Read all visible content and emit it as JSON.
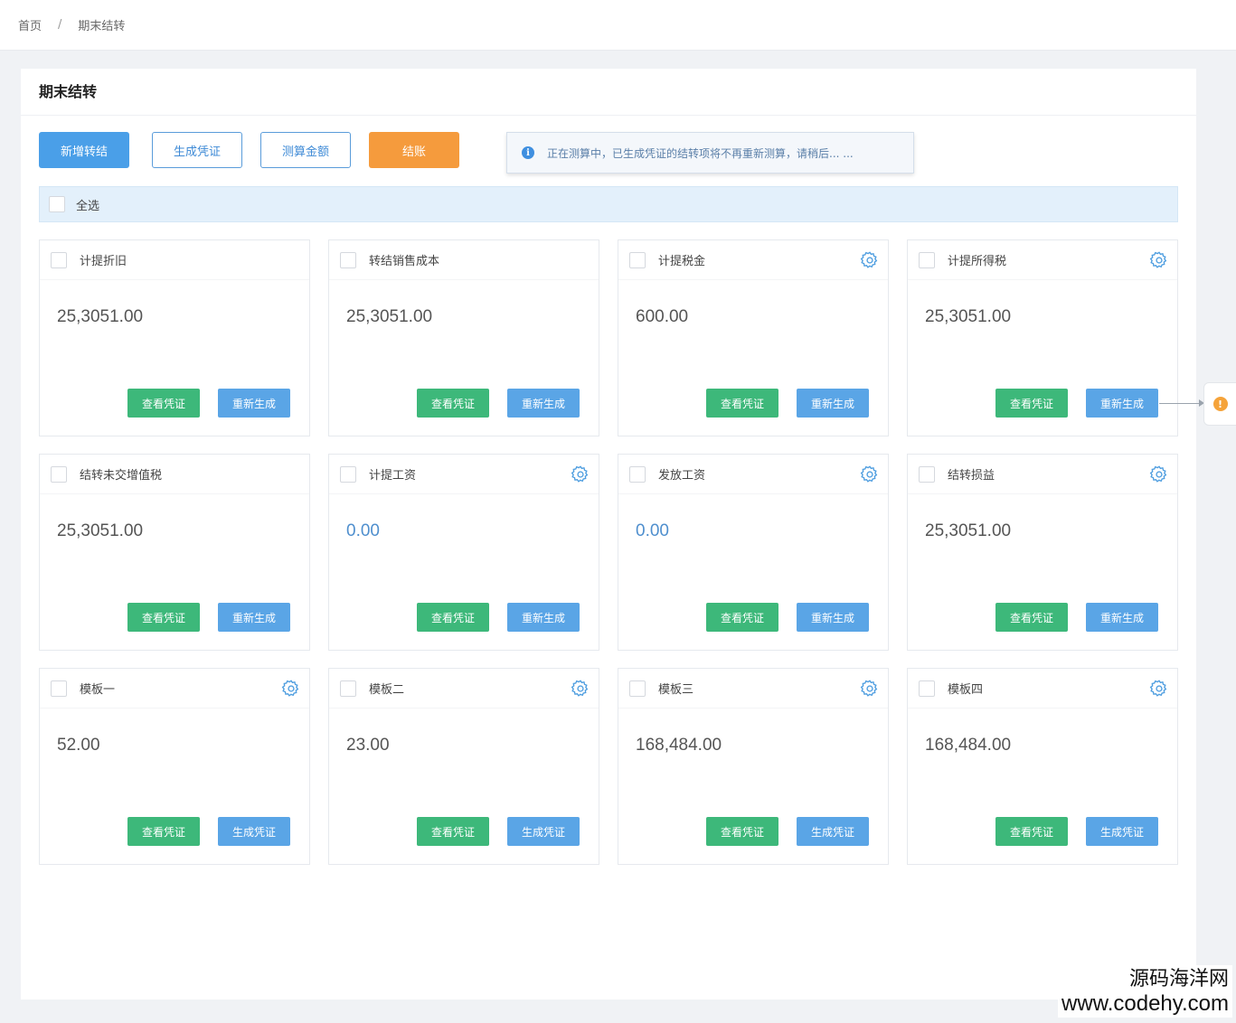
{
  "breadcrumb": {
    "home": "首页",
    "separator": "/",
    "current": "期末结转"
  },
  "panel": {
    "title": "期末结转"
  },
  "toolbar": {
    "add": "新增转结",
    "generate": "生成凭证",
    "calculate": "测算金额",
    "close": "结账"
  },
  "notice": {
    "icon": "i",
    "text": "正在测算中，已生成凭证的结转项将不再重新测算，请稍后... ..."
  },
  "select_all": {
    "label": "全选"
  },
  "cards": [
    {
      "title": "计提折旧",
      "value": "25,3051.00",
      "gear": false,
      "view": "查看凭证",
      "action": "重新生成"
    },
    {
      "title": "转结销售成本",
      "value": "25,3051.00",
      "gear": false,
      "view": "查看凭证",
      "action": "重新生成"
    },
    {
      "title": "计提税金",
      "value": "600.00",
      "gear": true,
      "view": "查看凭证",
      "action": "重新生成"
    },
    {
      "title": "计提所得税",
      "value": "25,3051.00",
      "gear": true,
      "view": "查看凭证",
      "action": "重新生成"
    },
    {
      "title": "结转未交增值税",
      "value": "25,3051.00",
      "gear": false,
      "view": "查看凭证",
      "action": "重新生成"
    },
    {
      "title": "计提工资",
      "value": "0.00",
      "gear": true,
      "view": "查看凭证",
      "action": "重新生成"
    },
    {
      "title": "发放工资",
      "value": "0.00",
      "gear": true,
      "view": "查看凭证",
      "action": "重新生成"
    },
    {
      "title": "结转损益",
      "value": "25,3051.00",
      "gear": true,
      "view": "查看凭证",
      "action": "重新生成"
    },
    {
      "title": "模板一",
      "value": "52.00",
      "gear": true,
      "view": "查看凭证",
      "action": "生成凭证"
    },
    {
      "title": "模板二",
      "value": "23.00",
      "gear": true,
      "view": "查看凭证",
      "action": "生成凭证"
    },
    {
      "title": "模板三",
      "value": "168,484.00",
      "gear": true,
      "view": "查看凭证",
      "action": "生成凭证"
    },
    {
      "title": "模板四",
      "value": "168,484.00",
      "gear": true,
      "view": "查看凭证",
      "action": "生成凭证"
    }
  ],
  "side_tab": {
    "icon": "!"
  },
  "watermark": {
    "line1": "源码海洋网",
    "line2": "www.codehy.com"
  },
  "colors": {
    "primary": "#4a9fe8",
    "green": "#3db87a",
    "blue_btn": "#5aa5e6",
    "orange": "#f59b3d",
    "select_bar": "#e3f0fb"
  }
}
